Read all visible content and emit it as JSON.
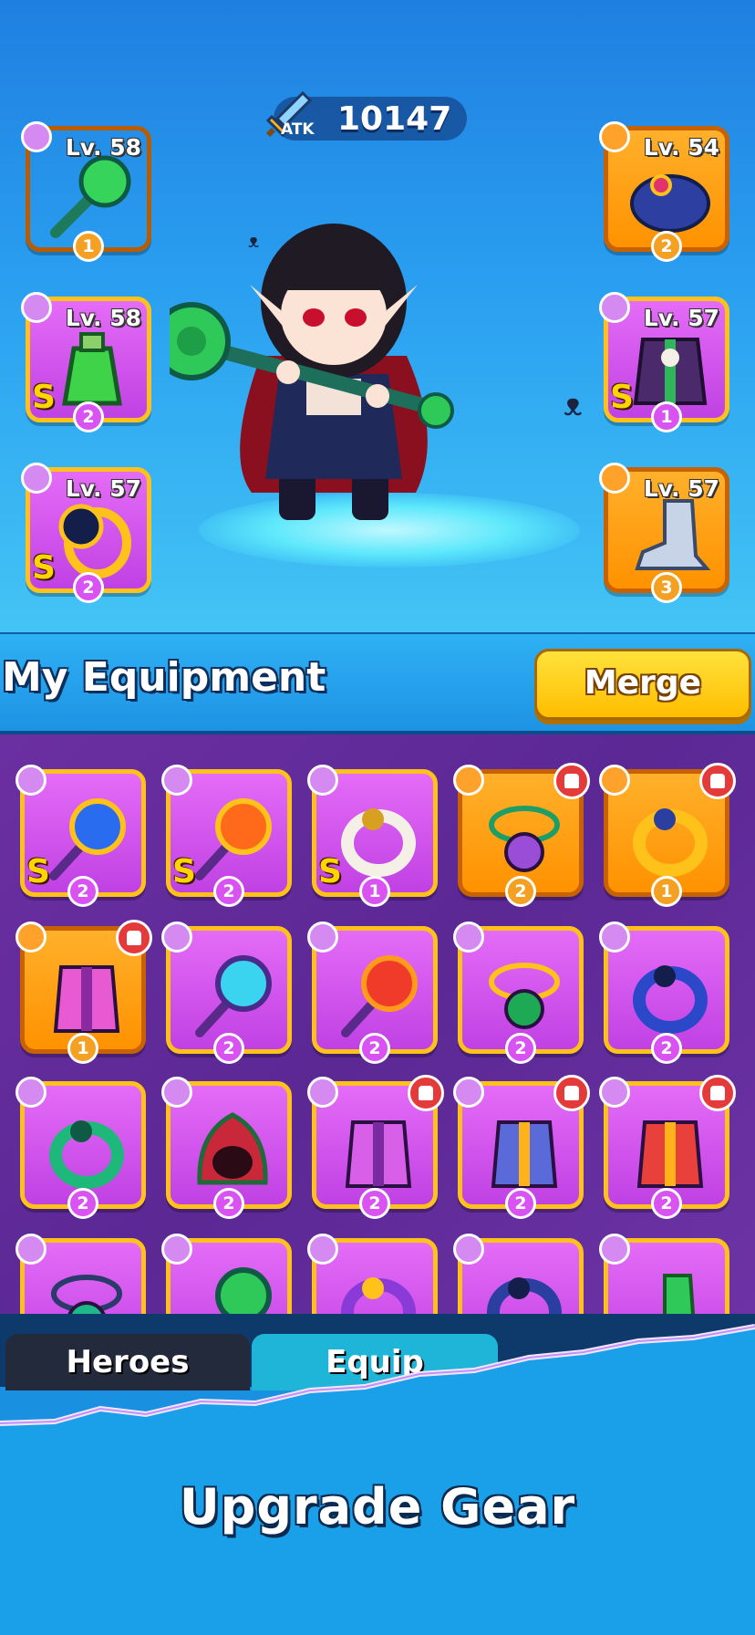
{
  "stats": {
    "atk_label": "ATK",
    "atk_value": "10147"
  },
  "equipped_left": [
    {
      "level": "Lv. 58",
      "count": "1",
      "rank": "",
      "frame": "orange",
      "type_icon": "staff-icon",
      "item": "green-staff-icon"
    },
    {
      "level": "Lv. 58",
      "count": "2",
      "rank": "S",
      "frame": "purple",
      "type_icon": "necklace-icon",
      "item": "potion-flask-icon"
    },
    {
      "level": "Lv. 57",
      "count": "2",
      "rank": "S",
      "frame": "purple",
      "type_icon": "ring-icon",
      "item": "dark-orb-ring-icon"
    }
  ],
  "equipped_right": [
    {
      "level": "Lv. 54",
      "count": "2",
      "rank": "",
      "frame": "orange",
      "type_icon": "hat-icon",
      "item": "turban-hat-icon"
    },
    {
      "level": "Lv. 57",
      "count": "1",
      "rank": "S",
      "frame": "purple",
      "type_icon": "armor-icon",
      "item": "skull-armor-icon"
    },
    {
      "level": "Lv. 57",
      "count": "3",
      "rank": "",
      "frame": "orange",
      "type_icon": "boot-icon",
      "item": "steel-boot-icon"
    }
  ],
  "section": {
    "title": "My Equipment",
    "merge_label": "Merge"
  },
  "inventory": [
    {
      "count": "2",
      "rank": "S",
      "frame": "purple",
      "type_icon": "staff-icon",
      "item": "blue-orb-staff-icon",
      "badge": false
    },
    {
      "count": "2",
      "rank": "S",
      "frame": "purple",
      "type_icon": "staff-icon",
      "item": "fire-eye-staff-icon",
      "badge": false
    },
    {
      "count": "1",
      "rank": "S",
      "frame": "purple",
      "type_icon": "ring-icon",
      "item": "skull-ring-icon",
      "badge": false
    },
    {
      "count": "2",
      "rank": "",
      "frame": "orange",
      "type_icon": "necklace-icon",
      "item": "amulet-icon",
      "badge": true
    },
    {
      "count": "1",
      "rank": "",
      "frame": "orange",
      "type_icon": "ring-icon",
      "item": "gold-ring-icon",
      "badge": true
    },
    {
      "count": "1",
      "rank": "",
      "frame": "orange",
      "type_icon": "armor-icon",
      "item": "pink-armor-icon",
      "badge": true
    },
    {
      "count": "2",
      "rank": "",
      "frame": "purple",
      "type_icon": "staff-icon",
      "item": "cyan-staff-icon",
      "badge": false
    },
    {
      "count": "2",
      "rank": "",
      "frame": "purple",
      "type_icon": "staff-icon",
      "item": "flame-staff-icon",
      "badge": false
    },
    {
      "count": "2",
      "rank": "",
      "frame": "purple",
      "type_icon": "necklace-icon",
      "item": "star-amulet-icon",
      "badge": false
    },
    {
      "count": "2",
      "rank": "",
      "frame": "purple",
      "type_icon": "ring-icon",
      "item": "blue-ring-icon",
      "badge": false
    },
    {
      "count": "2",
      "rank": "",
      "frame": "purple",
      "type_icon": "ring-icon",
      "item": "emerald-ring-icon",
      "badge": false
    },
    {
      "count": "2",
      "rank": "",
      "frame": "purple",
      "type_icon": "hat-icon",
      "item": "hood-icon",
      "badge": false
    },
    {
      "count": "2",
      "rank": "",
      "frame": "purple",
      "type_icon": "armor-icon",
      "item": "violet-armor-icon",
      "badge": true
    },
    {
      "count": "2",
      "rank": "",
      "frame": "purple",
      "type_icon": "armor-icon",
      "item": "blue-armor-icon",
      "badge": true
    },
    {
      "count": "2",
      "rank": "",
      "frame": "purple",
      "type_icon": "armor-icon",
      "item": "red-vest-icon",
      "badge": true
    },
    {
      "count": "",
      "rank": "",
      "frame": "purple",
      "type_icon": "necklace-icon",
      "item": "bead-necklace-icon",
      "badge": false
    },
    {
      "count": "",
      "rank": "",
      "frame": "purple",
      "type_icon": "staff-icon",
      "item": "green-orb-icon",
      "badge": false
    },
    {
      "count": "",
      "rank": "",
      "frame": "purple",
      "type_icon": "necklace-icon",
      "item": "purple-ring-icon",
      "badge": false
    },
    {
      "count": "",
      "rank": "",
      "frame": "purple",
      "type_icon": "ring-icon",
      "item": "navy-ring-icon",
      "badge": false
    },
    {
      "count": "",
      "rank": "",
      "frame": "purple",
      "type_icon": "boot-icon",
      "item": "green-boot-icon",
      "badge": false
    }
  ],
  "tabs": {
    "heroes": "Heroes",
    "equip": "Equip"
  },
  "caption": "Upgrade Gear",
  "colors": {
    "orange_frame": "#ff9a14",
    "purple_frame": "#d352f0",
    "accent_yellow": "#ffc21a"
  }
}
